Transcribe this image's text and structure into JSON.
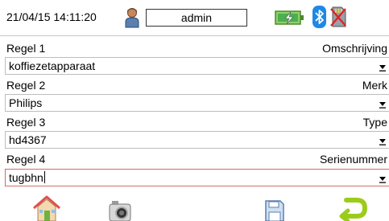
{
  "status": {
    "datetime": "21/04/15 14:11:20",
    "user": "admin",
    "icons": [
      "user-icon",
      "battery-charging-icon",
      "bluetooth-icon",
      "sd-card-missing-icon"
    ]
  },
  "rows": [
    {
      "label": "Regel 1",
      "right": "Omschrijving",
      "value": "koffiezetapparaat",
      "active": false
    },
    {
      "label": "Regel 2",
      "right": "Merk",
      "value": "Philips",
      "active": false
    },
    {
      "label": "Regel 3",
      "right": "Type",
      "value": "hd4367",
      "active": false
    },
    {
      "label": "Regel 4",
      "right": "Serienummer",
      "value": "tugbhn",
      "active": true
    }
  ],
  "footer": {
    "buttons": [
      "home-icon",
      "camera-icon",
      "save-icon",
      "back-arrow-icon"
    ]
  },
  "colors": {
    "active_border": "#d46a6a",
    "field_border": "#bdbdbd",
    "battery_green": "#4caf50",
    "bluetooth_blue": "#1e88e5",
    "back_arrow_green": "#9ccc1a"
  }
}
